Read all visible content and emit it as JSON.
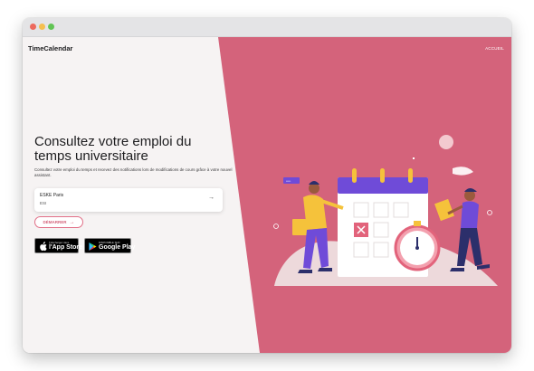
{
  "header": {
    "logo": "TimeCalendar",
    "access_link": "ACCUEIL"
  },
  "hero": {
    "title": "Consultez votre emploi du temps universitaire",
    "subtitle": "Consultez votre emploi du temps et recevez des notifications lors de modifications de cours grâce à votre nouvel assistant."
  },
  "school_select": {
    "name": "ESKE Paris",
    "code": "ESI",
    "arrow": "→"
  },
  "start_button": {
    "label": "DÉMARRER",
    "arrow": "→"
  },
  "badges": {
    "app_store_small": "Téléchargez dans",
    "app_store_big": "l'App Store",
    "google_play_small": "DISPONIBLE SUR",
    "google_play_big": "Google Play"
  },
  "colors": {
    "accent": "#d4637b",
    "background": "#f6f3f3",
    "calendar_header": "#6f4bd8"
  }
}
